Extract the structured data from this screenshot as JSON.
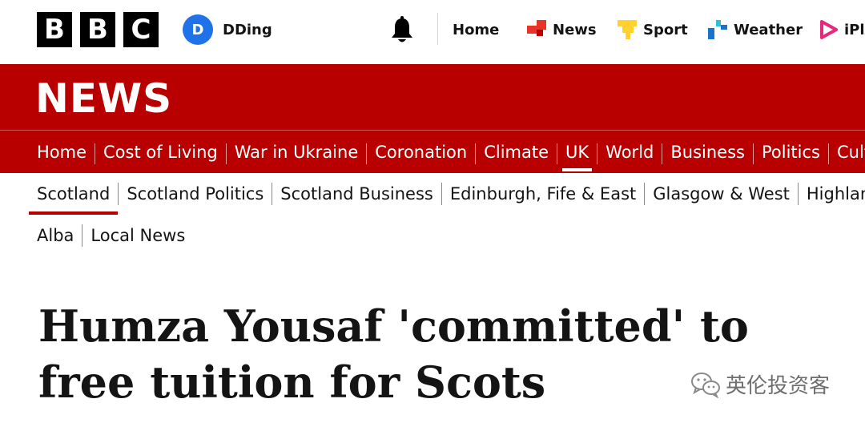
{
  "brand": {
    "logo_letters": [
      "B",
      "B",
      "C"
    ]
  },
  "account": {
    "initial": "D",
    "name": "DDing"
  },
  "top_nav": [
    {
      "label": "Home",
      "icon": ""
    },
    {
      "label": "News",
      "icon": "news-icon"
    },
    {
      "label": "Sport",
      "icon": "sport-icon"
    },
    {
      "label": "Weather",
      "icon": "weather-icon"
    },
    {
      "label": "iPla",
      "icon": "iplayer-icon"
    }
  ],
  "masthead": {
    "title": "NEWS"
  },
  "primary_nav": [
    "Home",
    "Cost of Living",
    "War in Ukraine",
    "Coronation",
    "Climate",
    "UK",
    "World",
    "Business",
    "Politics",
    "Cultu"
  ],
  "primary_nav_active": "UK",
  "secondary_nav": [
    "Scotland",
    "Scotland Politics",
    "Scotland Business",
    "Edinburgh, Fife & East",
    "Glasgow & West",
    "Highlands"
  ],
  "secondary_nav_row2": [
    "Alba",
    "Local News"
  ],
  "secondary_nav_active": "Scotland",
  "article": {
    "headline": "Humza Yousaf 'committed' to free tuition for Scots"
  },
  "watermark": {
    "text": "英伦投资客"
  },
  "colors": {
    "bbc_red": "#b80000",
    "avatar_blue": "#1f72e8",
    "news_icon_red": "#e8352a",
    "sport_yellow": "#ffd230",
    "weather_blue": "#1a73c9",
    "iplayer_pink": "#e8287a"
  }
}
